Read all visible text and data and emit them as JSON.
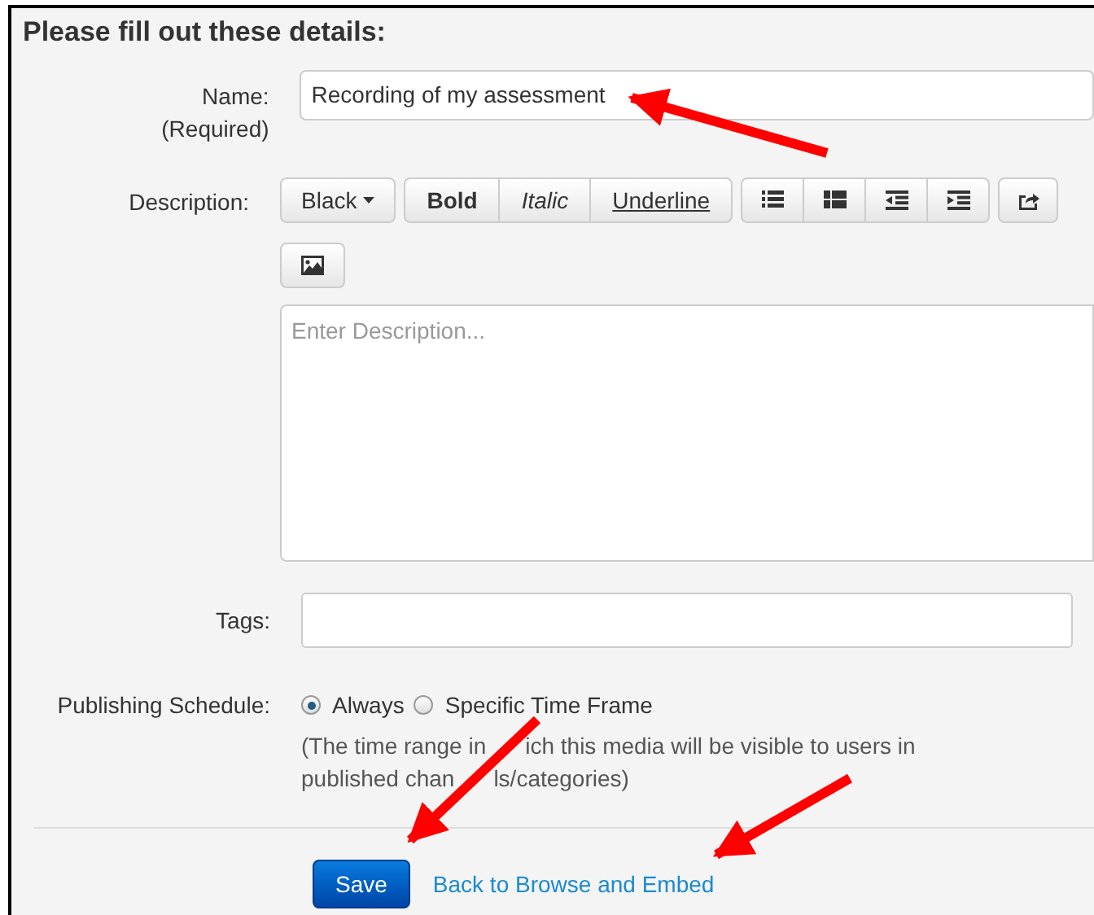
{
  "heading": "Please fill out these details:",
  "name": {
    "label": "Name:",
    "note": "(Required)",
    "value": "Recording of my assessment"
  },
  "description": {
    "label": "Description:",
    "color_menu": "Black",
    "format_buttons": [
      {
        "label": "Bold",
        "kind": "bold"
      },
      {
        "label": "Italic",
        "kind": "italic"
      },
      {
        "label": "Underline",
        "kind": "underline"
      }
    ],
    "placeholder": "Enter Description..."
  },
  "tags": {
    "label": "Tags:"
  },
  "schedule": {
    "label": "Publishing Schedule:",
    "options": [
      {
        "label": "Always",
        "selected": true
      },
      {
        "label": "Specific Time Frame",
        "selected": false
      }
    ],
    "help_lines": [
      [
        "(The time range in",
        "ich this media will be visible to users in"
      ],
      [
        "published chan",
        "ls/categories)"
      ]
    ]
  },
  "actions": {
    "save": "Save",
    "back_link": "Back to Browse and Embed"
  }
}
